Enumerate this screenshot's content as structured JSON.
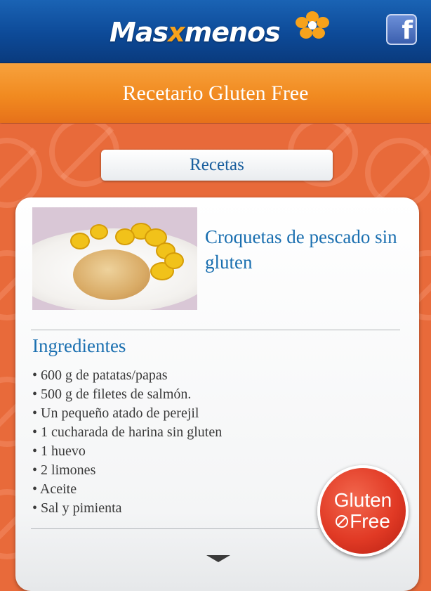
{
  "header": {
    "logo_text_pre": "Mas",
    "logo_text_x": "x",
    "logo_text_post": "menos",
    "facebook_icon": "facebook-icon"
  },
  "title_bar": {
    "title": "Recetario Gluten Free"
  },
  "nav": {
    "recetas_label": "Recetas"
  },
  "recipe": {
    "title": "Croquetas de pescado sin gluten",
    "ingredients_heading": "Ingredientes",
    "ingredients": [
      "600 g de patatas/papas",
      "500 g de filetes de salmón.",
      "Un pequeño atado de perejil",
      "1 cucharada de harina sin gluten",
      "1 huevo",
      "2 limones",
      "Aceite",
      "Sal y pimienta"
    ]
  },
  "badge": {
    "line1": "Gluten",
    "line2": "Free"
  },
  "colors": {
    "header_blue": "#0d4a98",
    "title_orange": "#f18a20",
    "accent_blue": "#1a6fb0",
    "badge_red": "#e13a25"
  }
}
